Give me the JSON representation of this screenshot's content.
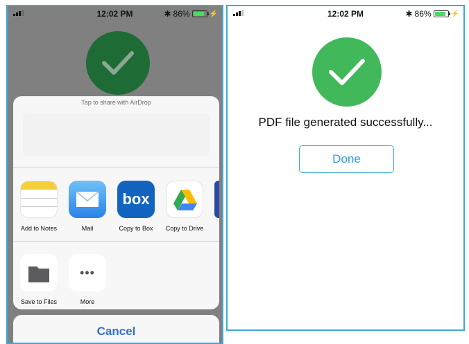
{
  "left": {
    "status": {
      "time": "12:02 PM",
      "battery": "86%"
    },
    "airdrop_label": "Tap to share with AirDrop",
    "apps": [
      {
        "label": "Add to Notes",
        "icon": "notes-icon"
      },
      {
        "label": "Mail",
        "icon": "mail-icon"
      },
      {
        "label": "Copy to Box",
        "icon": "box-icon",
        "glyph": "box"
      },
      {
        "label": "Copy to Drive",
        "icon": "drive-icon"
      }
    ],
    "actions": [
      {
        "label": "Save to Files",
        "icon": "folder-icon"
      },
      {
        "label": "More",
        "icon": "more-icon",
        "glyph": "•••"
      }
    ],
    "cancel_label": "Cancel"
  },
  "right": {
    "status": {
      "time": "12:02 PM",
      "battery": "86%"
    },
    "message": "PDF file generated successfully...",
    "done_label": "Done"
  },
  "colors": {
    "success_green": "#41b95a",
    "accent_blue": "#2a9fd6",
    "cancel_blue": "#2f6fd4"
  }
}
